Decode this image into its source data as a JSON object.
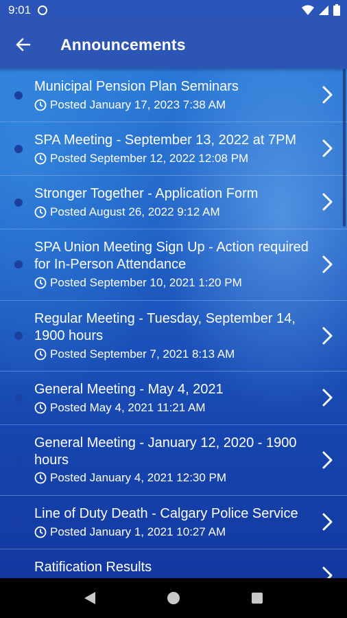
{
  "status_bar": {
    "time": "9:01"
  },
  "app_bar": {
    "title": "Announcements"
  },
  "colors": {
    "app_bar": "#2c55b6",
    "list_top": "#2a78d6",
    "list_bottom": "#1239a0",
    "dot": "#1d3f9e"
  },
  "announcements": [
    {
      "title": "Municipal Pension Plan Seminars",
      "posted": "Posted January 17, 2023 7:38 AM"
    },
    {
      "title": "SPA Meeting - September 13, 2022 at 7PM",
      "posted": "Posted September 12, 2022 12:08 PM"
    },
    {
      "title": "Stronger Together - Application Form",
      "posted": "Posted August 26, 2022 9:12 AM"
    },
    {
      "title": "SPA Union Meeting Sign Up - Action required for In-Person Attendance",
      "posted": "Posted September 10, 2021 1:20 PM"
    },
    {
      "title": "Regular Meeting - Tuesday, September 14, 1900 hours",
      "posted": "Posted September 7, 2021 8:13 AM"
    },
    {
      "title": "General Meeting - May 4, 2021",
      "posted": "Posted May 4, 2021 11:21 AM"
    },
    {
      "title": "General Meeting - January 12, 2020 - 1900 hours",
      "posted": "Posted January 4, 2021 12:30 PM"
    },
    {
      "title": "Line of Duty Death - Calgary Police Service",
      "posted": "Posted January 1, 2021 10:27 AM"
    },
    {
      "title": "Ratification Results",
      "posted": ""
    }
  ]
}
